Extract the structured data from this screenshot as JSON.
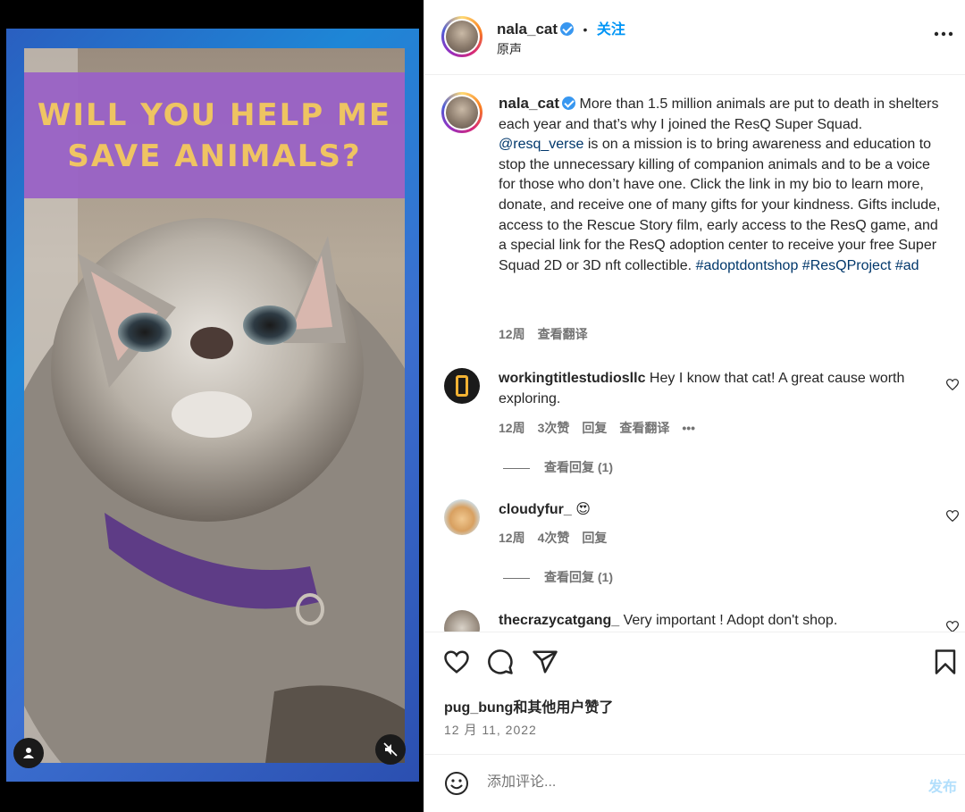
{
  "media": {
    "banner_line1": "WILL YOU HELP ME",
    "banner_line2": "SAVE ANIMALS?",
    "mute_icon": "speaker-muted-icon",
    "tagged_icon": "person-icon"
  },
  "header": {
    "username": "nala_cat",
    "follow_label": "关注",
    "separator": "•",
    "audio": "原声",
    "more_icon": "more-horizontal-icon"
  },
  "caption": {
    "username": "nala_cat",
    "text_part1": " More than 1.5 million animals are put to death in shelters each year and that’s why I joined the ResQ Super Squad. ",
    "mention": "@resq_verse",
    "text_part2": " is on a mission is to bring awareness and education to stop the unnecessary killing of companion animals and to be a voice for those who don’t have one. Click the link in my bio to learn more, donate, and receive one of many gifts for your kindness. Gifts include, access to the Rescue Story film, early access to the ResQ game, and a special link for the ResQ adoption center to receive your free Super Squad 2D or 3D nft collectible. ",
    "hashtag1": "#adoptdontshop",
    "hashtag2": "#ResQProject",
    "hashtag3": "#ad",
    "time": "12周",
    "translate": "查看翻译"
  },
  "comments": [
    {
      "username": "workingtitlestudiosllc",
      "text": " Hey I know that cat! A great cause worth exploring.",
      "time": "12周",
      "likes": "3次赞",
      "reply": "回复",
      "translate": "查看翻译",
      "more": "•••",
      "view_replies": "查看回复 (1)"
    },
    {
      "username": "cloudyfur_",
      "text": " 😍",
      "time": "12周",
      "likes": "4次赞",
      "reply": "回复",
      "view_replies": "查看回复 (1)"
    },
    {
      "username": "thecrazycatgang_",
      "text": " Very important ! Adopt don't shop."
    }
  ],
  "actions": {
    "like_icon": "heart-icon",
    "comment_icon": "comment-icon",
    "share_icon": "share-icon",
    "save_icon": "bookmark-icon",
    "likes_text": "pug_bung和其他用户赞了",
    "date": "12 月 11, 2022"
  },
  "comment_bar": {
    "emoji_icon": "emoji-icon",
    "placeholder": "添加评论...",
    "post_label": "发布"
  },
  "colors": {
    "link": "#00376b",
    "follow": "#0095f6",
    "banner_bg": "#9a63c6",
    "banner_text": "#f2c661",
    "post_disabled": "#b2dffc"
  }
}
